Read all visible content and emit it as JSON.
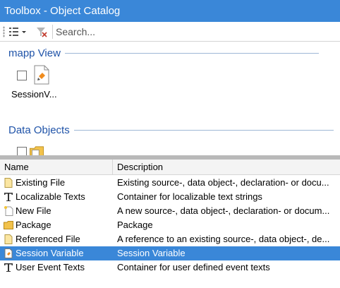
{
  "window": {
    "title": "Toolbox - Object Catalog"
  },
  "toolbar": {
    "view_icon": "view-options-icon",
    "filter_icon": "filter-clear-icon",
    "search_placeholder": "Search..."
  },
  "catalog": {
    "groups": [
      {
        "title": "mapp View",
        "items": [
          {
            "label": "SessionV...",
            "icon": "session-variable-file-icon"
          }
        ]
      },
      {
        "title": "Data Objects",
        "items": [
          {
            "label": "",
            "icon": "package-folder-icon"
          }
        ]
      }
    ]
  },
  "table": {
    "columns": [
      "Name",
      "Description"
    ],
    "rows": [
      {
        "name": "Existing File",
        "description": "Existing source-, data object-, declaration- or docu...",
        "icon": "file-icon"
      },
      {
        "name": "Localizable Texts",
        "description": "Container for localizable text strings",
        "icon": "text-t-icon"
      },
      {
        "name": "New File",
        "description": "A new source-, data object-, declaration- or docum...",
        "icon": "new-file-icon"
      },
      {
        "name": "Package",
        "description": "Package",
        "icon": "folder-icon"
      },
      {
        "name": "Referenced File",
        "description": "A reference to an existing source-, data object-, de...",
        "icon": "file-icon"
      },
      {
        "name": "Session Variable",
        "description": "Session Variable",
        "icon": "session-variable-icon",
        "selected": true
      },
      {
        "name": "User Event Texts",
        "description": "Container for user defined event texts",
        "icon": "text-t-icon"
      }
    ]
  },
  "colors": {
    "accent": "#3a87d8",
    "group_title": "#1f53a8",
    "selection": "#3a87d8"
  }
}
